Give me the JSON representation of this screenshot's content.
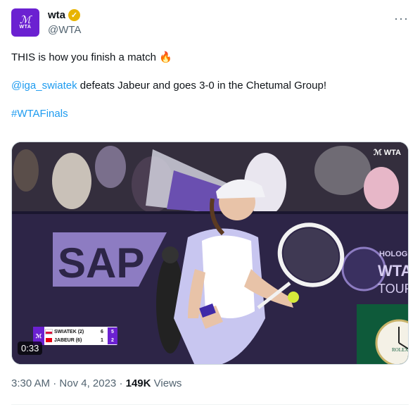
{
  "author": {
    "display_name": "wta",
    "handle": "@WTA",
    "avatar_text": "WTA",
    "verified_icon": "gold-check-badge"
  },
  "tweet": {
    "line1": "THIS is how you finish a match 🔥",
    "mention": "@iga_swiatek",
    "line2_rest": " defeats Jabeur and goes 3-0 in the Chetumal Group!",
    "hashtag": "#WTAFinals"
  },
  "media": {
    "watermark": "WTA",
    "sponsor_sap": "SAP",
    "sponsor_hologic": "HOLOGIC",
    "sponsor_wta": "WTA",
    "sponsor_tour": "TOUR",
    "clock_brand": "ROLEX",
    "duration": "0:33",
    "scoreboard": {
      "players": [
        {
          "name": "SWIATEK (2)",
          "set1": "6",
          "set2": "5",
          "flag_top": "#ffffff",
          "flag_bottom": "#dc143c"
        },
        {
          "name": "JABEUR (6)",
          "set1": "1",
          "set2": "2",
          "flag_top": "#e70013",
          "flag_bottom": "#e70013"
        }
      ]
    }
  },
  "meta": {
    "time": "3:30 AM",
    "date": "Nov 4, 2023",
    "views_count": "149K",
    "views_label": "Views"
  },
  "colors": {
    "link": "#1d9bf0",
    "brand_purple": "#6b21d1",
    "muted": "#536471"
  }
}
